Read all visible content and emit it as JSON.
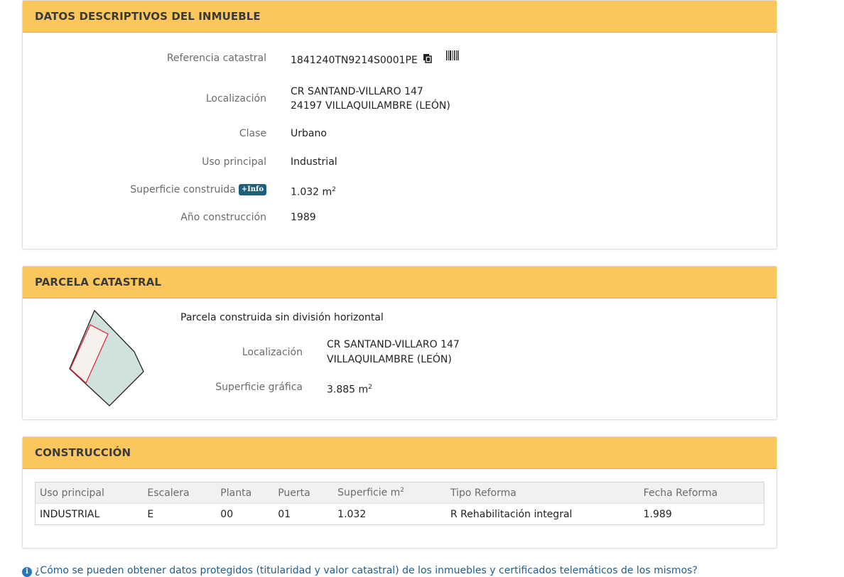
{
  "datos": {
    "title": "DATOS DESCRIPTIVOS DEL INMUEBLE",
    "ref_label": "Referencia catastral",
    "ref_value": "1841240TN9214S0001PE",
    "loc_label": "Localización",
    "loc_line1": "CR SANTAND-VILLARO 147",
    "loc_line2": "24197 VILLAQUILAMBRE (LEÓN)",
    "clase_label": "Clase",
    "clase_value": "Urbano",
    "uso_label": "Uso principal",
    "uso_value": "Industrial",
    "sup_label": "Superficie construida",
    "info_badge": "+Info",
    "sup_value": "1.032 m",
    "sup_unit_exp": "2",
    "anio_label": "Año construcción",
    "anio_value": "1989"
  },
  "parcela": {
    "title": "PARCELA CATASTRAL",
    "tipo": "Parcela construida sin división horizontal",
    "loc_label": "Localización",
    "loc_line1": "CR SANTAND-VILLARO 147",
    "loc_line2": "VILLAQUILAMBRE (LEÓN)",
    "sup_label": "Superficie gráfica",
    "sup_value": "3.885 m",
    "sup_unit_exp": "2"
  },
  "construccion": {
    "title": "CONSTRUCCIÓN",
    "headers": {
      "uso": "Uso principal",
      "escalera": "Escalera",
      "planta": "Planta",
      "puerta": "Puerta",
      "superficie": "Superficie m",
      "superficie_exp": "2",
      "tipo_reforma": "Tipo Reforma",
      "fecha_reforma": "Fecha Reforma"
    },
    "rows": [
      {
        "uso": "INDUSTRIAL",
        "escalera": "E",
        "planta": "00",
        "puerta": "01",
        "superficie": "1.032",
        "tipo_reforma": "R Rehabilitación integral",
        "fecha_reforma": "1.989"
      }
    ]
  },
  "footer": {
    "info_icon": "i",
    "link_text": "¿Cómo se pueden obtener datos protegidos (titularidad y valor catastral) de los inmuebles y certificados telemáticos de los mismos?"
  },
  "colors": {
    "heading_bg": "#fbc75c",
    "badge_bg": "#1f5f78",
    "parcel_fill": "#cfe3dc",
    "building_outline": "#e0304a",
    "link": "#1f5f8f"
  },
  "icons": {
    "copy": "copy-icon",
    "barcode": "barcode-icon",
    "info": "info-icon"
  }
}
